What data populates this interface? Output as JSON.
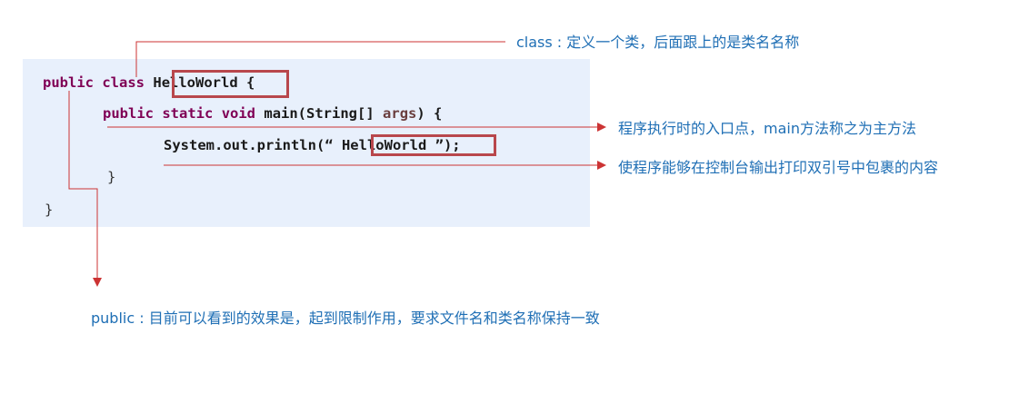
{
  "code": {
    "line1_kw1": "public",
    "line1_kw2": "class",
    "line1_classname": "HelloWorld",
    "line1_brace": "{",
    "line2_kw1": "public",
    "line2_kw2": "static",
    "line2_kw3": "void",
    "line2_method": "main(String[]",
    "line2_param": "args",
    "line2_end": ") {",
    "line3_pre": "System.out.println(“",
    "line3_str": " HelloWorld ",
    "line3_post": "”);",
    "line4_brace": "}",
    "line5_brace": "}"
  },
  "annotations": {
    "class_key": "class",
    "class_text": " : 定义一个类，后面跟上的是类名名称",
    "main_text": "程序执行时的入口点，main方法称之为主方法",
    "println_text": "使程序能够在控制台输出打印双引号中包裹的内容",
    "public_key": "public",
    "public_text": " : 目前可以看到的效果是，起到限制作用，要求文件名和类名称保持一致"
  },
  "colors": {
    "line": "#cc3333",
    "highlight_box": "#b8474c",
    "keyword": "#7f0055",
    "code_bg": "#e8f0fc",
    "annotation_key": "#1f6fb5"
  }
}
